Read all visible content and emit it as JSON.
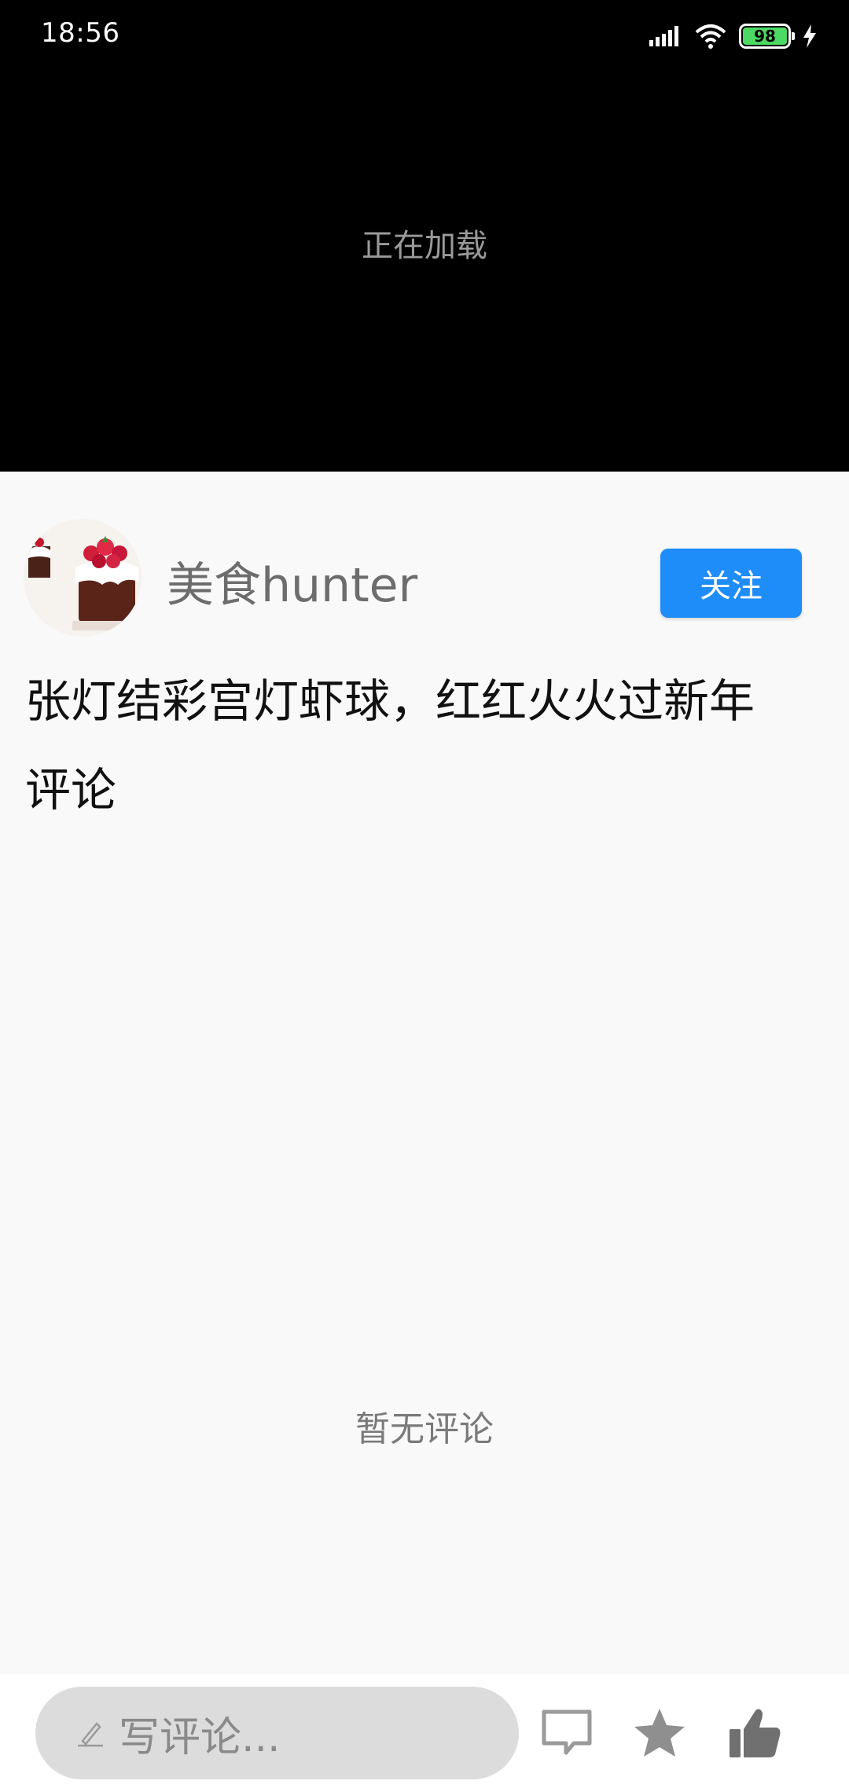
{
  "status_bar": {
    "time": "18:56",
    "battery": "98",
    "icons": [
      "signal-icon",
      "wifi-icon",
      "battery-icon",
      "charging-icon"
    ]
  },
  "player": {
    "loading_text": "正在加载"
  },
  "author": {
    "name": "美食hunter",
    "follow_label": "关注"
  },
  "post": {
    "title": "张灯结彩宫灯虾球，红红火火过新年"
  },
  "comments": {
    "heading": "评论",
    "empty_text": "暂无评论"
  },
  "bottom_bar": {
    "input_placeholder": "写评论...",
    "icons": [
      "comment-icon",
      "star-icon",
      "thumbs-up-icon"
    ]
  },
  "colors": {
    "accent": "#1e8cf9",
    "battery": "#4cd964",
    "icon_gray": "#707070"
  }
}
